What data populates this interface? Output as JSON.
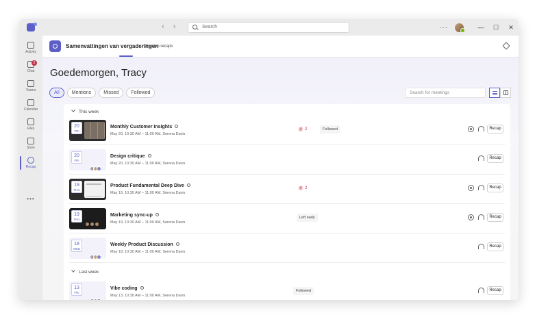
{
  "titlebar": {
    "back": "‹",
    "forward": "›",
    "search_placeholder": "Search",
    "more": "···",
    "minimize": "—",
    "maximize": "☐",
    "close": "✕"
  },
  "rail": {
    "items": [
      {
        "label": "Activity"
      },
      {
        "label": "Chat",
        "badge": "2"
      },
      {
        "label": "Teams"
      },
      {
        "label": "Calendar"
      },
      {
        "label": "Files"
      },
      {
        "label": "Store"
      },
      {
        "label": "Recap"
      }
    ],
    "more": "•••"
  },
  "app": {
    "title": "Samenvattingen van vergaderingen",
    "tab": "All video recaps"
  },
  "greeting": "Goedemorgen, Tracy",
  "filters": [
    "All",
    "Mentions",
    "Missed",
    "Followed"
  ],
  "meeting_search_placeholder": "Search for meetings",
  "sections": {
    "this_week": "This week",
    "last_week": "Last week"
  },
  "meetings": [
    {
      "day": "20",
      "weekday": "FRI",
      "title": "Monthly Customer Insights",
      "meta": "May 20, 10:30 AM – 11:00 AM, Serena Davis",
      "mentions": "2",
      "status": "Followed",
      "recap": "Recap"
    },
    {
      "day": "20",
      "weekday": "FRI",
      "title": "Design critique",
      "meta": "May 20, 10:30 AM – 11:00 AM, Serena Davis",
      "recap": "Recap"
    },
    {
      "day": "19",
      "weekday": "THU",
      "title": "Product Fundamental Deep Dive",
      "meta": "May 19, 10:30 AM – 11:00 AM, Serena Davis",
      "mentions": "2",
      "recap": "Recap"
    },
    {
      "day": "19",
      "weekday": "THU",
      "title": "Marketing sync-up",
      "meta": "May 19, 10:30 AM – 11:00 AM, Serena Davis",
      "status": "Left early",
      "recap": "Recap"
    },
    {
      "day": "18",
      "weekday": "WED",
      "title": "Weekly Product Discussion",
      "meta": "May 18, 10:30 AM – 11:00 AM, Serena Davis",
      "recap": "Recap"
    },
    {
      "day": "13",
      "weekday": "FRI",
      "title": "Vibe coding",
      "meta": "May 13, 10:30 AM – 11:00 AM, Serena Davis",
      "status": "Followed",
      "recap": "Recap"
    }
  ]
}
